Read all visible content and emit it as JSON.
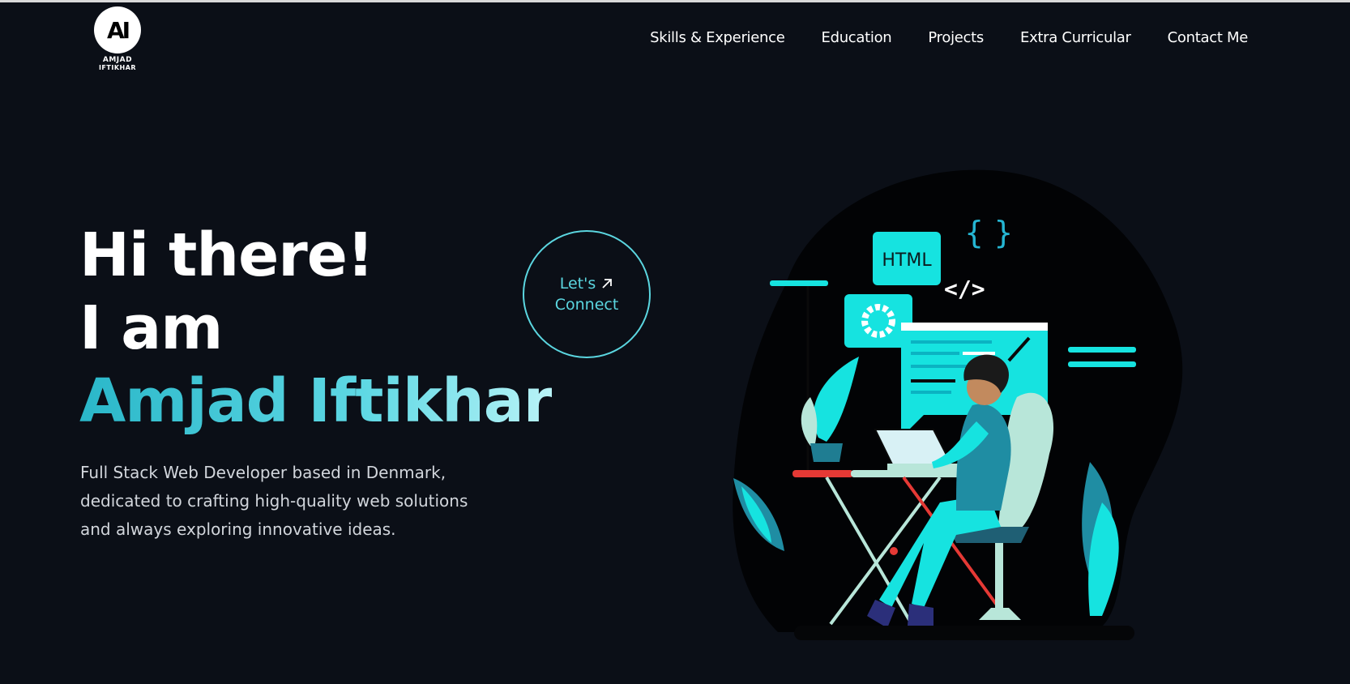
{
  "header": {
    "logo": {
      "line1": "AMJAD",
      "line2": "IFTIKHAR",
      "mark": "AI"
    },
    "nav": [
      "Skills & Experience",
      "Education",
      "Projects",
      "Extra Curricular",
      "Contact Me"
    ]
  },
  "hero": {
    "greeting": "Hi there!",
    "intro": "I am",
    "name": "Amjad Iftikhar",
    "tagline": "Full Stack Web Developer based in Denmark, dedicated to crafting high-quality web solutions and always exploring innovative ideas.",
    "connect_line1": "Let's",
    "connect_line2": "Connect",
    "connect_icon": "arrow-up-right-icon"
  },
  "illustration": {
    "html_label": "HTML",
    "braces": "{   }",
    "code_tag": "</>"
  },
  "colors": {
    "background": "#0b0f17",
    "accent": "#5bd6e0",
    "cyan": "#16e3e0",
    "red": "#e53935"
  }
}
